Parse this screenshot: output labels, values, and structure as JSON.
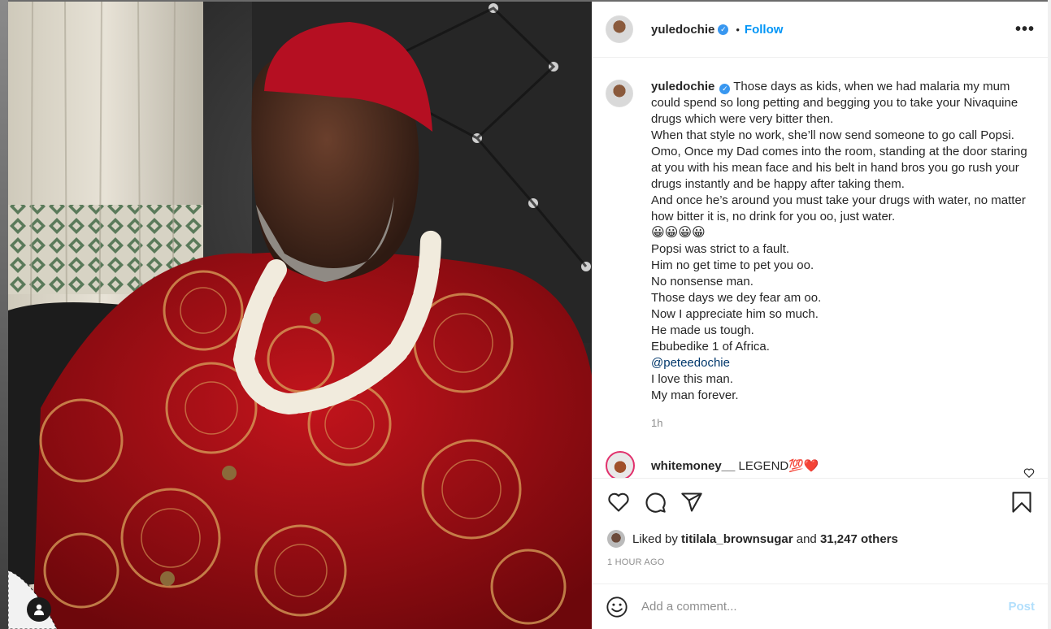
{
  "post": {
    "username": "yuledochie",
    "verified_mark": "✓",
    "dot": "•",
    "follow_label": "Follow",
    "more_label": "•••"
  },
  "caption": {
    "username": "yuledochie",
    "lines": [
      "Those days as kids, when we had malaria my mum could spend so long petting and begging you to take your Nivaquine drugs which were very bitter then.",
      "When that style no work, she’ll now send someone to go call Popsi.",
      "Omo, Once my Dad comes into the room, standing at the door staring at you with his mean face and his belt in hand bros you go rush your drugs instantly and be happy after taking them.",
      "And once he’s around you must take your drugs with water, no matter how bitter it is, no drink for you oo, just water.",
      "😀😀😀😀",
      "Popsi was strict to a fault.",
      "Him no get time to pet you oo.",
      "No nonsense man.",
      "Those days we dey fear am oo.",
      "Now I appreciate him so much.",
      "He made us tough.",
      "Ebubedike 1 of Africa."
    ],
    "mention": "@peteedochie",
    "after_lines": [
      "I love this man.",
      "My man forever."
    ],
    "time": "1h"
  },
  "comment": {
    "username": "whitemoney__",
    "text": "LEGEND💯❤️"
  },
  "likes": {
    "prefix": "Liked by",
    "user": "titilala_brownsugar",
    "and": "and",
    "others": "31,247 others"
  },
  "posted_time": "1 HOUR AGO",
  "add_comment": {
    "placeholder": "Add a comment...",
    "post_label": "Post"
  },
  "icons": {
    "header_avatar": "avatar",
    "like": "heart-icon",
    "comment": "comment-bubble-icon",
    "share": "paper-plane-icon",
    "save": "bookmark-icon",
    "emoji": "smiley-icon",
    "tag": "user-tag-icon"
  },
  "colors": {
    "accent": "#0095f6",
    "verified": "#3897f0",
    "post_disabled": "#b2dffc"
  }
}
